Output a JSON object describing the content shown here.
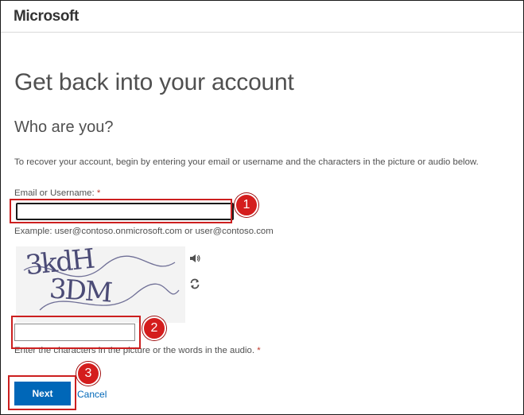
{
  "header": {
    "brand": "Microsoft"
  },
  "main": {
    "title": "Get back into your account",
    "subtitle": "Who are you?",
    "instructions": "To recover your account, begin by entering your email or username and the characters in the picture or audio below.",
    "email_label": "Email or Username: ",
    "required_mark": "*",
    "email_value": "",
    "example": "Example: user@contoso.onmicrosoft.com or user@contoso.com",
    "captcha": {
      "line1": "3kdH",
      "line2": "3DM",
      "audio_icon": "speaker-icon",
      "refresh_icon": "refresh-icon",
      "input_value": "",
      "hint": "Enter the characters in the picture or the words in the audio. "
    },
    "next_label": "Next",
    "cancel_label": "Cancel"
  },
  "annotations": [
    "1",
    "2",
    "3"
  ],
  "colors": {
    "accent": "#0067b8",
    "annotation": "#cc1f1f",
    "text": "#505050"
  }
}
